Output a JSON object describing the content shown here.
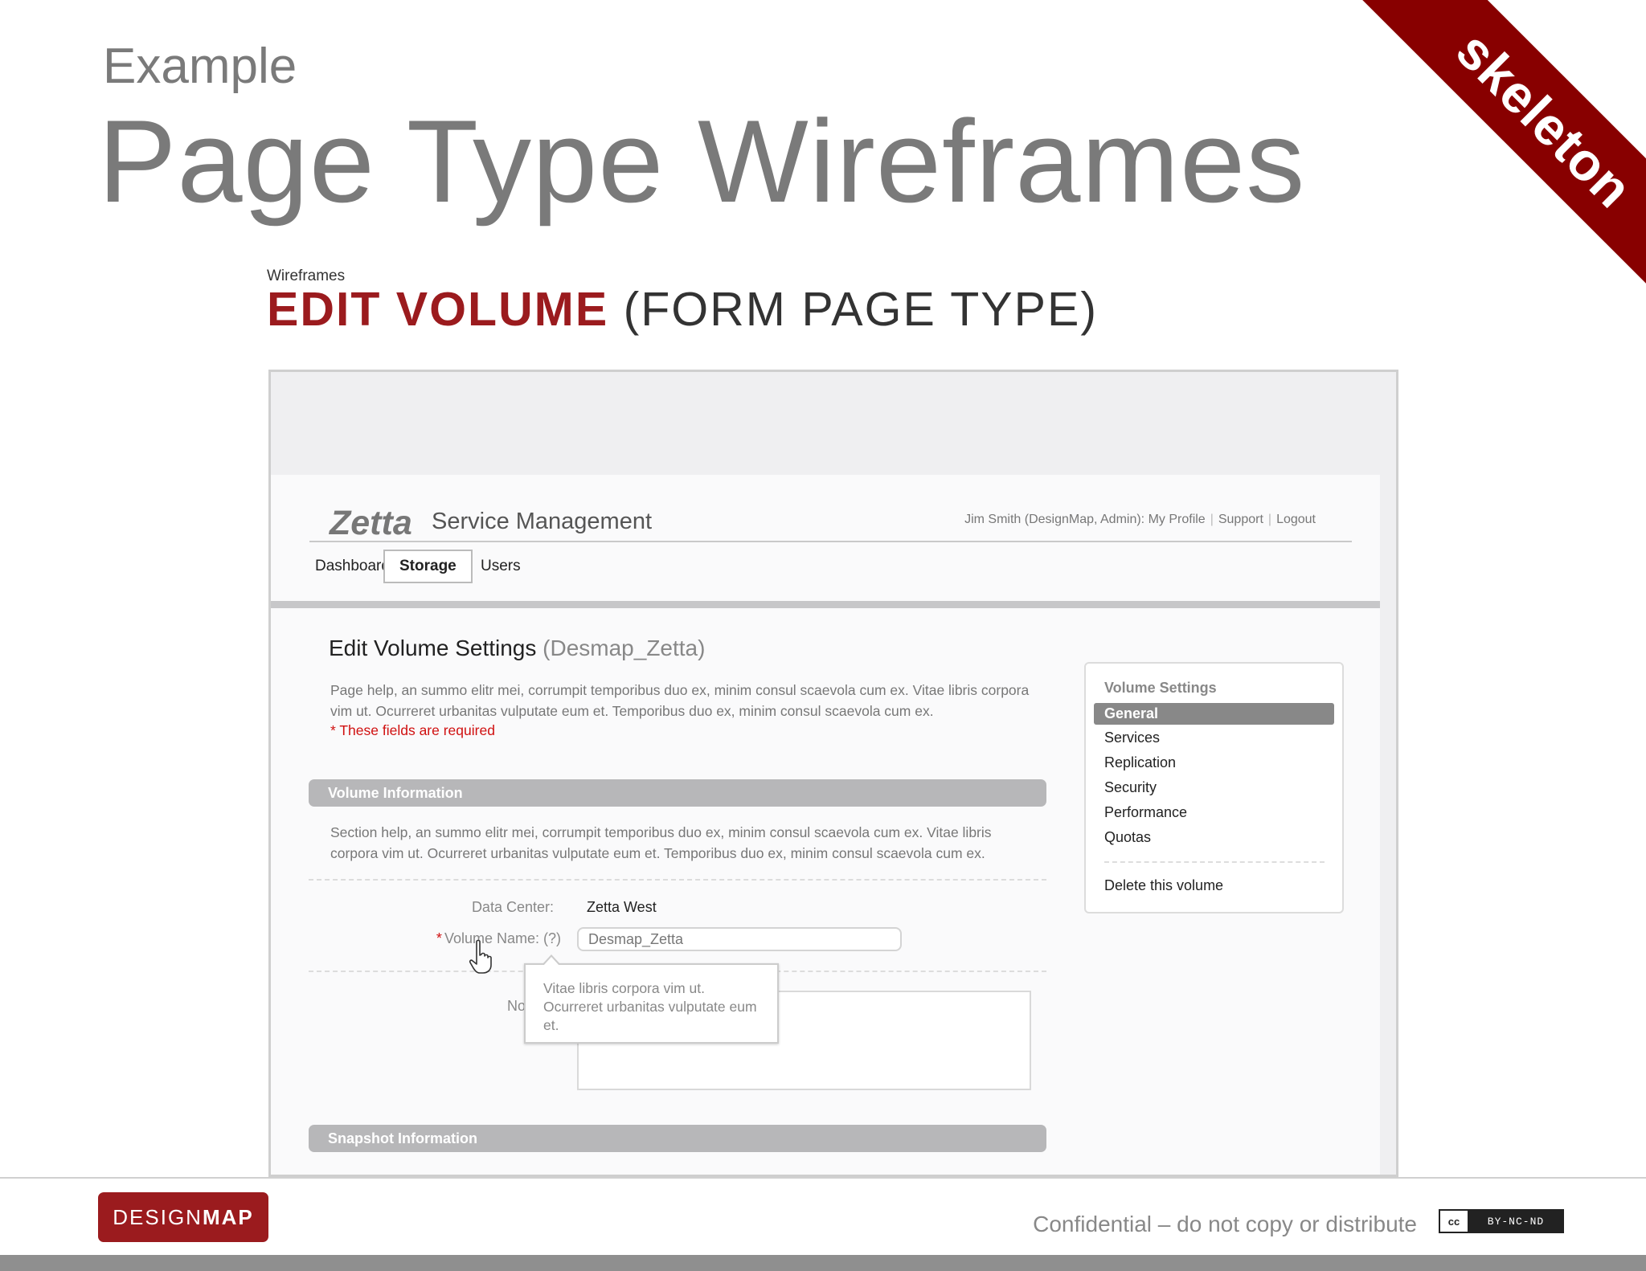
{
  "slide": {
    "eyebrow": "Example",
    "title": "Page Type Wireframes",
    "corner_banner": "skeleton",
    "wireframe_label": "Wireframes",
    "wireframe_title_strong": "EDIT VOLUME",
    "wireframe_title_rest": "(FORM PAGE TYPE)"
  },
  "app": {
    "logo": "Zetta",
    "title": "Service Management",
    "user": "Jim Smith (DesignMap, Admin):",
    "header_links": [
      "My Profile",
      "Support",
      "Logout"
    ],
    "nav": [
      {
        "label": "Dashboard",
        "active": false
      },
      {
        "label": "Storage",
        "active": true
      },
      {
        "label": "Users",
        "active": false
      }
    ]
  },
  "page": {
    "title": "Edit Volume Settings",
    "subtitle": "(Desmap_Zetta)",
    "help_text": "Page help, an summo elitr mei, corrumpit temporibus duo ex, minim consul scaevola cum ex. Vitae libris corpora vim ut. Ocurreret urbanitas vulputate eum et. Temporibus duo ex, minim consul scaevola cum ex.",
    "required_note": "* These fields are required"
  },
  "sections": {
    "volume_info": {
      "title": "Volume Information",
      "help_text": "Section help, an summo elitr mei, corrumpit temporibus duo ex, minim consul scaevola cum ex. Vitae libris corpora vim ut. Ocurreret urbanitas vulputate eum et. Temporibus duo ex, minim consul scaevola cum ex."
    },
    "snapshot_info": {
      "title": "Snapshot Information"
    }
  },
  "form": {
    "data_center_label": "Data Center:",
    "data_center_value": "Zetta West",
    "required_star": "*",
    "volume_name_label": "Volume Name: (?)",
    "volume_name_value": "Desmap_Zetta",
    "notes_label": "Note"
  },
  "tooltip": {
    "text": "Vitae libris corpora vim ut. Ocurreret urbanitas vulputate eum et."
  },
  "side_panel": {
    "title": "Volume Settings",
    "items": [
      {
        "label": "General",
        "active": true
      },
      {
        "label": "Services",
        "active": false
      },
      {
        "label": "Replication",
        "active": false
      },
      {
        "label": "Security",
        "active": false
      },
      {
        "label": "Performance",
        "active": false
      },
      {
        "label": "Quotas",
        "active": false
      }
    ],
    "delete_link": "Delete this volume"
  },
  "footer": {
    "logo_light": "DESIGN",
    "logo_bold": "MAP",
    "confidential": "Confidential – do not copy or distribute",
    "cc_icon": "cc",
    "license": "BY-NC-ND"
  },
  "colors": {
    "brand_red": "#9b1b1e",
    "banner_red": "#880000",
    "required_red": "#d01010",
    "section_gray": "#b7b7b9"
  }
}
